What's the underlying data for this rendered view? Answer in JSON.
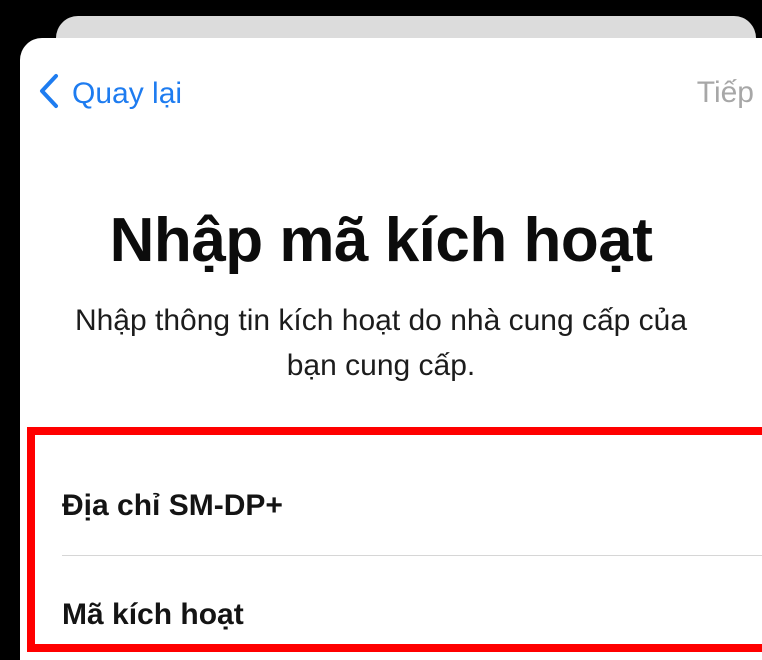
{
  "nav": {
    "back_label": "Quay lại",
    "next_label": "Tiếp"
  },
  "page": {
    "title": "Nhập mã kích hoạt",
    "subtitle": "Nhập thông tin kích hoạt do nhà cung cấp của bạn cung cấp."
  },
  "form": {
    "fields": [
      {
        "label": "Địa chỉ SM-DP+",
        "value": ""
      },
      {
        "label": "Mã kích hoạt",
        "value": ""
      }
    ]
  },
  "colors": {
    "accent": "#1e7cf0",
    "disabled": "#a7a7a7",
    "highlight_border": "#ff0000"
  }
}
